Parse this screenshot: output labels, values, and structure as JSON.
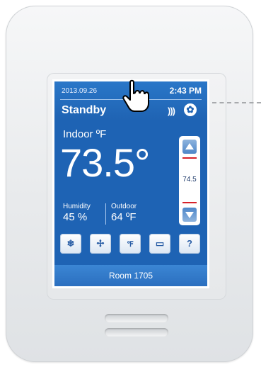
{
  "screen": {
    "date": "2013.09.26",
    "time": "2:43 PM",
    "mode": "Standby",
    "indoor_label": "Indoor ºF",
    "temperature": "73.5°",
    "humidity_label": "Humidity",
    "humidity_value": "45 %",
    "outdoor_label": "Outdoor",
    "outdoor_value": "64 ºF",
    "setpoint": "74.5",
    "room": "Room 1705"
  },
  "icons": {
    "heat": "heat-waves-icon",
    "fan_status": "fan-circle-icon",
    "mode_button": "system-mode-icon",
    "fan_button": "fan-icon",
    "units_button": "units-icon",
    "message_button": "message-icon",
    "help_button": "help-icon"
  },
  "colors": {
    "screen_blue": "#1e63b4",
    "setpoint_marker": "#d6222a"
  }
}
